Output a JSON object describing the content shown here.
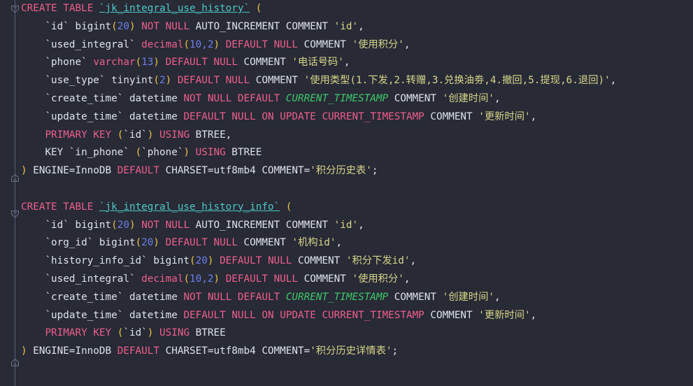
{
  "editor": {
    "name": "sql-code-editor",
    "background": "#282a36",
    "language": "sql",
    "font_size_px": 14,
    "line_height_px": 26,
    "colors": {
      "background": "#282a36",
      "keyword": "#ef5f8c",
      "table_identifier": "#4ec9c4",
      "string": "#d7d78a",
      "number": "#6d7fe8",
      "paren": "#e8c547",
      "function_italic": "#3ec96a",
      "plain_text": "#dfe3ec",
      "gutter_rail": "#5b6070"
    }
  },
  "gutter": {
    "fold_markers": [
      {
        "name": "fold-start-table-1",
        "icon": "chevron-down-fold-icon",
        "line": 0
      },
      {
        "name": "fold-end-table-1",
        "icon": "fold-end-icon",
        "line": 9
      },
      {
        "name": "fold-start-table-2",
        "icon": "chevron-down-fold-icon",
        "line": 11
      },
      {
        "name": "fold-end-table-2",
        "icon": "fold-end-icon",
        "line": 20
      }
    ]
  },
  "code": {
    "lines": [
      {
        "n": 1,
        "indent": 0,
        "tokens": [
          {
            "t": "CREATE",
            "c": "kw"
          },
          {
            "t": " ",
            "c": "plain"
          },
          {
            "t": "TABLE",
            "c": "kw"
          },
          {
            "t": " ",
            "c": "plain"
          },
          {
            "t": "`jk_integral_use_history`",
            "c": "ident"
          },
          {
            "t": " ",
            "c": "plain"
          },
          {
            "t": "(",
            "c": "paren"
          }
        ]
      },
      {
        "n": 2,
        "indent": 1,
        "tokens": [
          {
            "t": "`id`",
            "c": "col"
          },
          {
            "t": " ",
            "c": "plain"
          },
          {
            "t": "bigint",
            "c": "type2"
          },
          {
            "t": "(",
            "c": "paren"
          },
          {
            "t": "20",
            "c": "num"
          },
          {
            "t": ")",
            "c": "paren"
          },
          {
            "t": " ",
            "c": "plain"
          },
          {
            "t": "NOT",
            "c": "kw"
          },
          {
            "t": " ",
            "c": "plain"
          },
          {
            "t": "NULL",
            "c": "kw"
          },
          {
            "t": " AUTO_INCREMENT COMMENT ",
            "c": "plain"
          },
          {
            "t": "'id'",
            "c": "str"
          },
          {
            "t": ",",
            "c": "punct"
          }
        ]
      },
      {
        "n": 3,
        "indent": 1,
        "tokens": [
          {
            "t": "`used_integral`",
            "c": "col"
          },
          {
            "t": " ",
            "c": "plain"
          },
          {
            "t": "decimal",
            "c": "type"
          },
          {
            "t": "(",
            "c": "paren"
          },
          {
            "t": "10",
            "c": "num"
          },
          {
            "t": ",",
            "c": "num"
          },
          {
            "t": "2",
            "c": "num"
          },
          {
            "t": ")",
            "c": "paren"
          },
          {
            "t": " ",
            "c": "plain"
          },
          {
            "t": "DEFAULT",
            "c": "kw"
          },
          {
            "t": " ",
            "c": "plain"
          },
          {
            "t": "NULL",
            "c": "kw"
          },
          {
            "t": " COMMENT ",
            "c": "plain"
          },
          {
            "t": "'使用积分'",
            "c": "str"
          },
          {
            "t": ",",
            "c": "punct"
          }
        ]
      },
      {
        "n": 4,
        "indent": 1,
        "tokens": [
          {
            "t": "`phone`",
            "c": "col"
          },
          {
            "t": " ",
            "c": "plain"
          },
          {
            "t": "varchar",
            "c": "type"
          },
          {
            "t": "(",
            "c": "paren"
          },
          {
            "t": "13",
            "c": "num"
          },
          {
            "t": ")",
            "c": "paren"
          },
          {
            "t": " ",
            "c": "plain"
          },
          {
            "t": "DEFAULT",
            "c": "kw"
          },
          {
            "t": " ",
            "c": "plain"
          },
          {
            "t": "NULL",
            "c": "kw"
          },
          {
            "t": " COMMENT ",
            "c": "plain"
          },
          {
            "t": "'电话号码'",
            "c": "str"
          },
          {
            "t": ",",
            "c": "punct"
          }
        ]
      },
      {
        "n": 5,
        "indent": 1,
        "tokens": [
          {
            "t": "`use_type`",
            "c": "col"
          },
          {
            "t": " ",
            "c": "plain"
          },
          {
            "t": "tinyint",
            "c": "type2"
          },
          {
            "t": "(",
            "c": "paren"
          },
          {
            "t": "2",
            "c": "num"
          },
          {
            "t": ")",
            "c": "paren"
          },
          {
            "t": " ",
            "c": "plain"
          },
          {
            "t": "DEFAULT",
            "c": "kw"
          },
          {
            "t": " ",
            "c": "plain"
          },
          {
            "t": "NULL",
            "c": "kw"
          },
          {
            "t": " COMMENT ",
            "c": "plain"
          },
          {
            "t": "'使用类型(1.下发,2.转赠,3.兑换油劵,4.撤回,5.提现,6.退回)'",
            "c": "str"
          },
          {
            "t": ",",
            "c": "punct"
          }
        ]
      },
      {
        "n": 6,
        "indent": 1,
        "tokens": [
          {
            "t": "`create_time`",
            "c": "col"
          },
          {
            "t": " ",
            "c": "plain"
          },
          {
            "t": "datetime",
            "c": "type2"
          },
          {
            "t": " ",
            "c": "plain"
          },
          {
            "t": "NOT",
            "c": "kw"
          },
          {
            "t": " ",
            "c": "plain"
          },
          {
            "t": "NULL",
            "c": "kw"
          },
          {
            "t": " ",
            "c": "plain"
          },
          {
            "t": "DEFAULT",
            "c": "kw"
          },
          {
            "t": " ",
            "c": "plain"
          },
          {
            "t": "CURRENT_TIMESTAMP",
            "c": "fn"
          },
          {
            "t": " COMMENT ",
            "c": "plain"
          },
          {
            "t": "'创建时间'",
            "c": "str"
          },
          {
            "t": ",",
            "c": "punct"
          }
        ]
      },
      {
        "n": 7,
        "indent": 1,
        "tokens": [
          {
            "t": "`update_time`",
            "c": "col"
          },
          {
            "t": " ",
            "c": "plain"
          },
          {
            "t": "datetime",
            "c": "type2"
          },
          {
            "t": " ",
            "c": "plain"
          },
          {
            "t": "DEFAULT",
            "c": "kw"
          },
          {
            "t": " ",
            "c": "plain"
          },
          {
            "t": "NULL",
            "c": "kw"
          },
          {
            "t": " ",
            "c": "plain"
          },
          {
            "t": "ON",
            "c": "kw"
          },
          {
            "t": " ",
            "c": "plain"
          },
          {
            "t": "UPDATE",
            "c": "kw"
          },
          {
            "t": " ",
            "c": "plain"
          },
          {
            "t": "CURRENT_TIMESTAMP",
            "c": "kw"
          },
          {
            "t": " COMMENT ",
            "c": "plain"
          },
          {
            "t": "'更新时间'",
            "c": "str"
          },
          {
            "t": ",",
            "c": "punct"
          }
        ]
      },
      {
        "n": 8,
        "indent": 1,
        "tokens": [
          {
            "t": "PRIMARY",
            "c": "kw"
          },
          {
            "t": " ",
            "c": "plain"
          },
          {
            "t": "KEY",
            "c": "kw"
          },
          {
            "t": " ",
            "c": "plain"
          },
          {
            "t": "(",
            "c": "paren"
          },
          {
            "t": "`id`",
            "c": "col"
          },
          {
            "t": ")",
            "c": "paren"
          },
          {
            "t": " ",
            "c": "plain"
          },
          {
            "t": "USING",
            "c": "kw"
          },
          {
            "t": " BTREE",
            "c": "plain"
          },
          {
            "t": ",",
            "c": "punct"
          }
        ]
      },
      {
        "n": 9,
        "indent": 1,
        "tokens": [
          {
            "t": "KEY ",
            "c": "plain"
          },
          {
            "t": "`in_phone`",
            "c": "col"
          },
          {
            "t": " ",
            "c": "plain"
          },
          {
            "t": "(",
            "c": "paren"
          },
          {
            "t": "`phone`",
            "c": "col"
          },
          {
            "t": ")",
            "c": "paren"
          },
          {
            "t": " ",
            "c": "plain"
          },
          {
            "t": "USING",
            "c": "kw"
          },
          {
            "t": " BTREE",
            "c": "plain"
          }
        ]
      },
      {
        "n": 10,
        "indent": 0,
        "tokens": [
          {
            "t": ")",
            "c": "paren"
          },
          {
            "t": " ENGINE=InnoDB ",
            "c": "plain"
          },
          {
            "t": "DEFAULT",
            "c": "kw"
          },
          {
            "t": " CHARSET=utf8mb4 COMMENT=",
            "c": "plain"
          },
          {
            "t": "'积分历史表'",
            "c": "str"
          },
          {
            "t": ";",
            "c": "punct"
          }
        ]
      },
      {
        "n": 11,
        "indent": 0,
        "tokens": []
      },
      {
        "n": 12,
        "indent": 0,
        "tokens": [
          {
            "t": "CREATE",
            "c": "kw"
          },
          {
            "t": " ",
            "c": "plain"
          },
          {
            "t": "TABLE",
            "c": "kw"
          },
          {
            "t": " ",
            "c": "plain"
          },
          {
            "t": "`jk_integral_use_history_info`",
            "c": "ident"
          },
          {
            "t": " ",
            "c": "plain"
          },
          {
            "t": "(",
            "c": "paren"
          }
        ]
      },
      {
        "n": 13,
        "indent": 1,
        "tokens": [
          {
            "t": "`id`",
            "c": "col"
          },
          {
            "t": " ",
            "c": "plain"
          },
          {
            "t": "bigint",
            "c": "type2"
          },
          {
            "t": "(",
            "c": "paren"
          },
          {
            "t": "20",
            "c": "num"
          },
          {
            "t": ")",
            "c": "paren"
          },
          {
            "t": " ",
            "c": "plain"
          },
          {
            "t": "NOT",
            "c": "kw"
          },
          {
            "t": " ",
            "c": "plain"
          },
          {
            "t": "NULL",
            "c": "kw"
          },
          {
            "t": " AUTO_INCREMENT COMMENT ",
            "c": "plain"
          },
          {
            "t": "'id'",
            "c": "str"
          },
          {
            "t": ",",
            "c": "punct"
          }
        ]
      },
      {
        "n": 14,
        "indent": 1,
        "tokens": [
          {
            "t": "`org_id`",
            "c": "col"
          },
          {
            "t": " ",
            "c": "plain"
          },
          {
            "t": "bigint",
            "c": "type2"
          },
          {
            "t": "(",
            "c": "paren"
          },
          {
            "t": "20",
            "c": "num"
          },
          {
            "t": ")",
            "c": "paren"
          },
          {
            "t": " ",
            "c": "plain"
          },
          {
            "t": "DEFAULT",
            "c": "kw"
          },
          {
            "t": " ",
            "c": "plain"
          },
          {
            "t": "NULL",
            "c": "kw"
          },
          {
            "t": " COMMENT ",
            "c": "plain"
          },
          {
            "t": "'机构id'",
            "c": "str"
          },
          {
            "t": ",",
            "c": "punct"
          }
        ]
      },
      {
        "n": 15,
        "indent": 1,
        "tokens": [
          {
            "t": "`history_info_id`",
            "c": "col"
          },
          {
            "t": " ",
            "c": "plain"
          },
          {
            "t": "bigint",
            "c": "type2"
          },
          {
            "t": "(",
            "c": "paren"
          },
          {
            "t": "20",
            "c": "num"
          },
          {
            "t": ")",
            "c": "paren"
          },
          {
            "t": " ",
            "c": "plain"
          },
          {
            "t": "DEFAULT",
            "c": "kw"
          },
          {
            "t": " ",
            "c": "plain"
          },
          {
            "t": "NULL",
            "c": "kw"
          },
          {
            "t": " COMMENT ",
            "c": "plain"
          },
          {
            "t": "'积分下发id'",
            "c": "str"
          },
          {
            "t": ",",
            "c": "punct"
          }
        ]
      },
      {
        "n": 16,
        "indent": 1,
        "tokens": [
          {
            "t": "`used_integral`",
            "c": "col"
          },
          {
            "t": " ",
            "c": "plain"
          },
          {
            "t": "decimal",
            "c": "type"
          },
          {
            "t": "(",
            "c": "paren"
          },
          {
            "t": "10",
            "c": "num"
          },
          {
            "t": ",",
            "c": "num"
          },
          {
            "t": "2",
            "c": "num"
          },
          {
            "t": ")",
            "c": "paren"
          },
          {
            "t": " ",
            "c": "plain"
          },
          {
            "t": "DEFAULT",
            "c": "kw"
          },
          {
            "t": " ",
            "c": "plain"
          },
          {
            "t": "NULL",
            "c": "kw"
          },
          {
            "t": " COMMENT ",
            "c": "plain"
          },
          {
            "t": "'使用积分'",
            "c": "str"
          },
          {
            "t": ",",
            "c": "punct"
          }
        ]
      },
      {
        "n": 17,
        "indent": 1,
        "tokens": [
          {
            "t": "`create_time`",
            "c": "col"
          },
          {
            "t": " ",
            "c": "plain"
          },
          {
            "t": "datetime",
            "c": "type2"
          },
          {
            "t": " ",
            "c": "plain"
          },
          {
            "t": "NOT",
            "c": "kw"
          },
          {
            "t": " ",
            "c": "plain"
          },
          {
            "t": "NULL",
            "c": "kw"
          },
          {
            "t": " ",
            "c": "plain"
          },
          {
            "t": "DEFAULT",
            "c": "kw"
          },
          {
            "t": " ",
            "c": "plain"
          },
          {
            "t": "CURRENT_TIMESTAMP",
            "c": "fn"
          },
          {
            "t": " COMMENT ",
            "c": "plain"
          },
          {
            "t": "'创建时间'",
            "c": "str"
          },
          {
            "t": ",",
            "c": "punct"
          }
        ]
      },
      {
        "n": 18,
        "indent": 1,
        "tokens": [
          {
            "t": "`update_time`",
            "c": "col"
          },
          {
            "t": " ",
            "c": "plain"
          },
          {
            "t": "datetime",
            "c": "type2"
          },
          {
            "t": " ",
            "c": "plain"
          },
          {
            "t": "DEFAULT",
            "c": "kw"
          },
          {
            "t": " ",
            "c": "plain"
          },
          {
            "t": "NULL",
            "c": "kw"
          },
          {
            "t": " ",
            "c": "plain"
          },
          {
            "t": "ON",
            "c": "kw"
          },
          {
            "t": " ",
            "c": "plain"
          },
          {
            "t": "UPDATE",
            "c": "kw"
          },
          {
            "t": " ",
            "c": "plain"
          },
          {
            "t": "CURRENT_TIMESTAMP",
            "c": "kw"
          },
          {
            "t": " COMMENT ",
            "c": "plain"
          },
          {
            "t": "'更新时间'",
            "c": "str"
          },
          {
            "t": ",",
            "c": "punct"
          }
        ]
      },
      {
        "n": 19,
        "indent": 1,
        "tokens": [
          {
            "t": "PRIMARY",
            "c": "kw"
          },
          {
            "t": " ",
            "c": "plain"
          },
          {
            "t": "KEY",
            "c": "kw"
          },
          {
            "t": " ",
            "c": "plain"
          },
          {
            "t": "(",
            "c": "paren"
          },
          {
            "t": "`id`",
            "c": "col"
          },
          {
            "t": ")",
            "c": "paren"
          },
          {
            "t": " ",
            "c": "plain"
          },
          {
            "t": "USING",
            "c": "kw"
          },
          {
            "t": " BTREE",
            "c": "plain"
          }
        ]
      },
      {
        "n": 20,
        "indent": 0,
        "tokens": [
          {
            "t": ")",
            "c": "paren"
          },
          {
            "t": " ENGINE=InnoDB ",
            "c": "plain"
          },
          {
            "t": "DEFAULT",
            "c": "kw"
          },
          {
            "t": " CHARSET=utf8mb4 COMMENT=",
            "c": "plain"
          },
          {
            "t": "'积分历史详情表'",
            "c": "str"
          },
          {
            "t": ";",
            "c": "punct"
          }
        ]
      }
    ]
  }
}
